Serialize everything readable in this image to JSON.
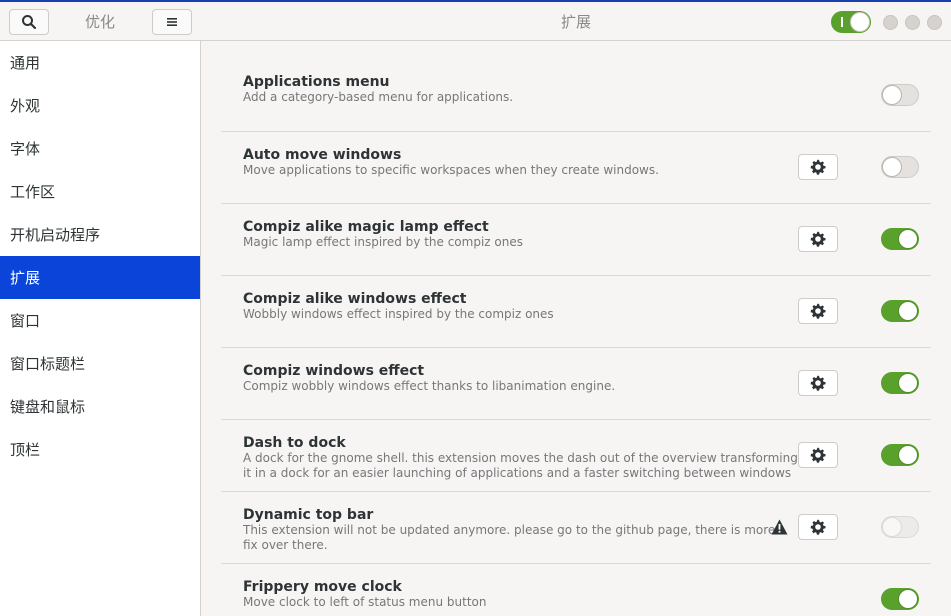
{
  "titlebar": {
    "left_title": "优化",
    "center_title": "扩展",
    "extensions_enabled": true
  },
  "sidebar": {
    "items": [
      {
        "label": "通用"
      },
      {
        "label": "外观"
      },
      {
        "label": "字体"
      },
      {
        "label": "工作区"
      },
      {
        "label": "开机启动程序"
      },
      {
        "label": "扩展",
        "selected": true
      },
      {
        "label": "窗口"
      },
      {
        "label": "窗口标题栏"
      },
      {
        "label": "键盘和鼠标"
      },
      {
        "label": "顶栏"
      }
    ]
  },
  "extensions": [
    {
      "name": "Applications menu",
      "desc": "Add a category-based menu for applications.",
      "has_settings": false,
      "warning": false,
      "state": "off"
    },
    {
      "name": "Auto move windows",
      "desc": "Move applications to specific workspaces when they create windows.",
      "has_settings": true,
      "warning": false,
      "state": "off"
    },
    {
      "name": "Compiz alike magic lamp effect",
      "desc": "Magic lamp effect inspired by the compiz ones",
      "has_settings": true,
      "warning": false,
      "state": "on"
    },
    {
      "name": "Compiz alike windows effect",
      "desc": "Wobbly windows effect inspired by the compiz ones",
      "has_settings": true,
      "warning": false,
      "state": "on"
    },
    {
      "name": "Compiz windows effect",
      "desc": "Compiz wobbly windows effect thanks to libanimation engine.",
      "has_settings": true,
      "warning": false,
      "state": "on"
    },
    {
      "name": "Dash to dock",
      "desc": "A dock for the gnome shell. this extension moves the dash out of the overview transforming it in a dock for an easier launching of applications and a faster switching between windows and desktops. s…",
      "has_settings": true,
      "warning": false,
      "state": "on"
    },
    {
      "name": "Dynamic top bar",
      "desc": "This extension will not be updated anymore. please go to the github page, there is more fix over there.",
      "has_settings": true,
      "warning": true,
      "state": "disabled"
    },
    {
      "name": "Frippery move clock",
      "desc": "Move clock to left of status menu button",
      "has_settings": false,
      "warning": false,
      "state": "on"
    }
  ],
  "colors": {
    "accent": "#0b44d8",
    "switch_on": "#5aa02c"
  }
}
